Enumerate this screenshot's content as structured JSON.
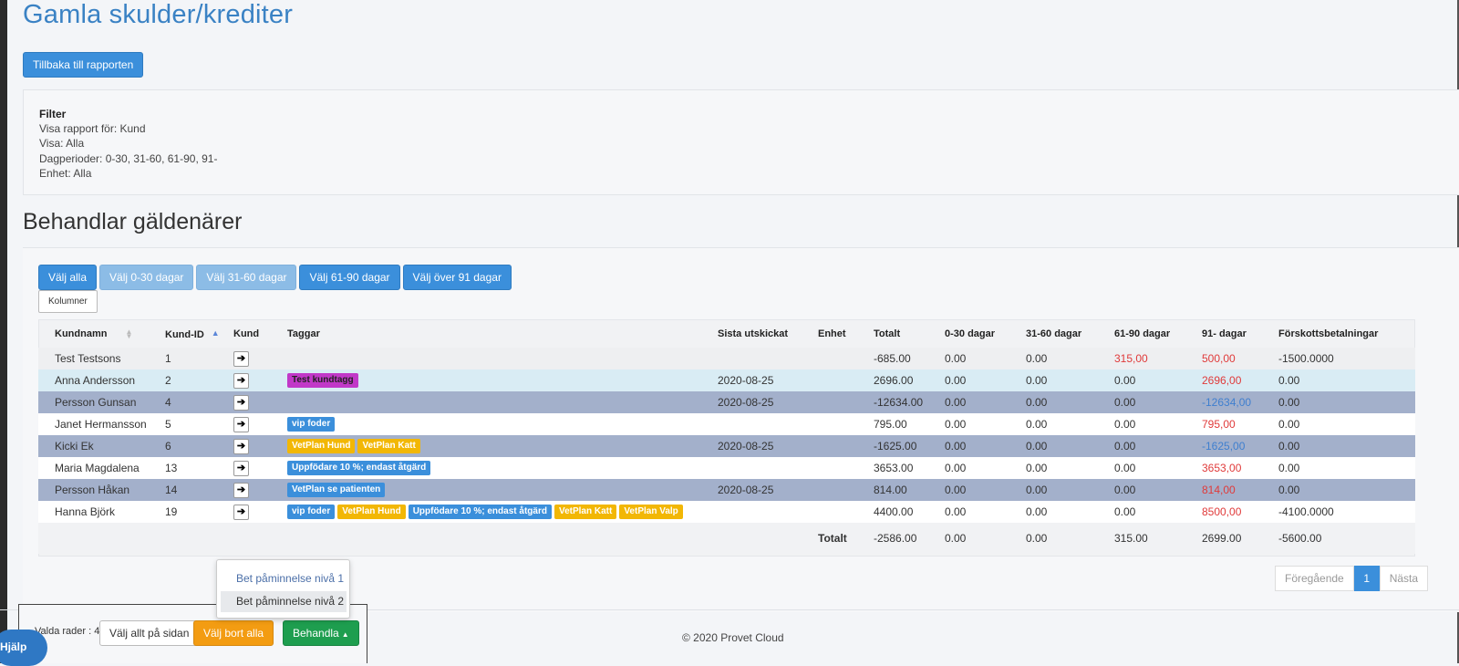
{
  "page": {
    "title": "Gamla skulder/krediter",
    "back_button": "Tillbaka till rapporten"
  },
  "filter": {
    "title": "Filter",
    "lines": [
      "Visa rapport för: Kund",
      "Visa: Alla",
      "Dagperioder: 0-30, 31-60, 61-90, 91-",
      "Enhet: Alla"
    ]
  },
  "section": {
    "title": "Behandlar gäldenärer"
  },
  "select_buttons": [
    "Välj alla",
    "Välj 0-30 dagar",
    "Välj 31-60 dagar",
    "Välj 61-90 dagar",
    "Välj över 91 dagar"
  ],
  "columns_button": "Kolumner",
  "table": {
    "headers": [
      "Kundnamn",
      "Kund-ID",
      "Kund",
      "Taggar",
      "Sista utskickat",
      "Enhet",
      "Totalt",
      "0-30 dagar",
      "31-60 dagar",
      "61-90 dagar",
      "91- dagar",
      "Förskottsbetalningar"
    ],
    "rows": [
      {
        "name": "Test Testsons",
        "id": "1",
        "tags": [],
        "sent": "",
        "unit": "",
        "total": "-685.00",
        "d0": "0.00",
        "d31": "0.00",
        "d61": "315,00",
        "d91": "500,00",
        "adv": "-1500.0000"
      },
      {
        "name": "Anna Andersson",
        "id": "2",
        "tags": [
          "Test kundtagg"
        ],
        "sent": "2020-08-25",
        "unit": "",
        "total": "2696.00",
        "d0": "0.00",
        "d31": "0.00",
        "d61": "0.00",
        "d91": "2696,00",
        "adv": "0.00"
      },
      {
        "name": "Persson Gunsan",
        "id": "4",
        "tags": [],
        "sent": "2020-08-25",
        "unit": "",
        "total": "-12634.00",
        "d0": "0.00",
        "d31": "0.00",
        "d61": "0.00",
        "d91": "-12634,00",
        "adv": "0.00"
      },
      {
        "name": "Janet Hermansson",
        "id": "5",
        "tags": [
          "vip foder"
        ],
        "sent": "",
        "unit": "",
        "total": "795.00",
        "d0": "0.00",
        "d31": "0.00",
        "d61": "0.00",
        "d91": "795,00",
        "adv": "0.00"
      },
      {
        "name": "Kicki Ek",
        "id": "6",
        "tags": [
          "VetPlan Hund",
          "VetPlan Katt"
        ],
        "sent": "2020-08-25",
        "unit": "",
        "total": "-1625.00",
        "d0": "0.00",
        "d31": "0.00",
        "d61": "0.00",
        "d91": "-1625,00",
        "adv": "0.00"
      },
      {
        "name": "Maria Magdalena",
        "id": "13",
        "tags": [
          "Uppfödare 10 %; endast åtgärd"
        ],
        "sent": "",
        "unit": "",
        "total": "3653.00",
        "d0": "0.00",
        "d31": "0.00",
        "d61": "0.00",
        "d91": "3653,00",
        "adv": "0.00"
      },
      {
        "name": "Persson Håkan",
        "id": "14",
        "tags": [
          "VetPlan se patienten"
        ],
        "sent": "2020-08-25",
        "unit": "",
        "total": "814.00",
        "d0": "0.00",
        "d31": "0.00",
        "d61": "0.00",
        "d91": "814,00",
        "adv": "0.00"
      },
      {
        "name": "Hanna Björk",
        "id": "19",
        "tags": [
          "vip foder",
          "VetPlan Hund",
          "Uppfödare 10 %; endast åtgärd",
          "VetPlan Katt",
          "VetPlan Valp"
        ],
        "sent": "",
        "unit": "",
        "total": "4400.00",
        "d0": "0.00",
        "d31": "0.00",
        "d61": "0.00",
        "d91": "8500,00",
        "adv": "-4100.0000"
      }
    ],
    "totals": {
      "label": "Totalt",
      "total": "-2586.00",
      "d0": "0.00",
      "d31": "0.00",
      "d61": "315.00",
      "d91": "2699.00",
      "adv": "-5600.00"
    }
  },
  "pager": {
    "prev": "Föregående",
    "current": "1",
    "next": "Nästa"
  },
  "action_bar": {
    "selected_label": "Valda rader : 4",
    "select_page": "Välj allt på sidan",
    "deselect_all": "Välj bort alla",
    "process": "Behandla"
  },
  "dropdown": {
    "items": [
      "Bet påminnelse nivå 1",
      "Bet påminnelse nivå 2"
    ]
  },
  "footer": {
    "copyright": "© 2020 Provet Cloud"
  },
  "help": {
    "label": "Hjälp"
  },
  "colors": {
    "accent": "#3b8fdb",
    "red_value": "#e03a3a",
    "tag_yellow": "#f2b705",
    "tag_pink": "#c138c8"
  }
}
